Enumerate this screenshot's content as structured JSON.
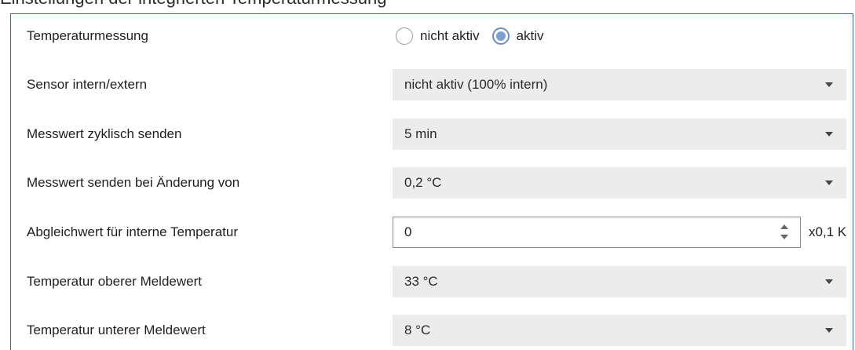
{
  "caption": "Einstellungen der integrierten Temperaturmessung",
  "rows": [
    {
      "label": "Temperaturmessung",
      "type": "radio",
      "options": [
        "nicht aktiv",
        "aktiv"
      ],
      "selected": "aktiv"
    },
    {
      "label": "Sensor intern/extern",
      "type": "select",
      "value": "nicht aktiv (100% intern)"
    },
    {
      "label": "Messwert zyklisch senden",
      "type": "select",
      "value": "5 min"
    },
    {
      "label": "Messwert senden bei Änderung von",
      "type": "select",
      "value": "0,2 °C"
    },
    {
      "label": "Abgleichwert für interne Temperatur",
      "type": "spinbox",
      "value": "0",
      "unit": "x0,1 K"
    },
    {
      "label": "Temperatur oberer Meldewert",
      "type": "select",
      "value": "33 °C"
    },
    {
      "label": "Temperatur unterer Meldewert",
      "type": "select",
      "value": "8 °C"
    }
  ],
  "colors": {
    "panel_border": "#3c6f9e",
    "select_background": "#ececec",
    "radio_selected": "#7f9fd0"
  },
  "icons": {
    "dropdown": "chevron-down-icon",
    "spin_up": "spin-up-icon",
    "spin_down": "spin-down-icon"
  }
}
